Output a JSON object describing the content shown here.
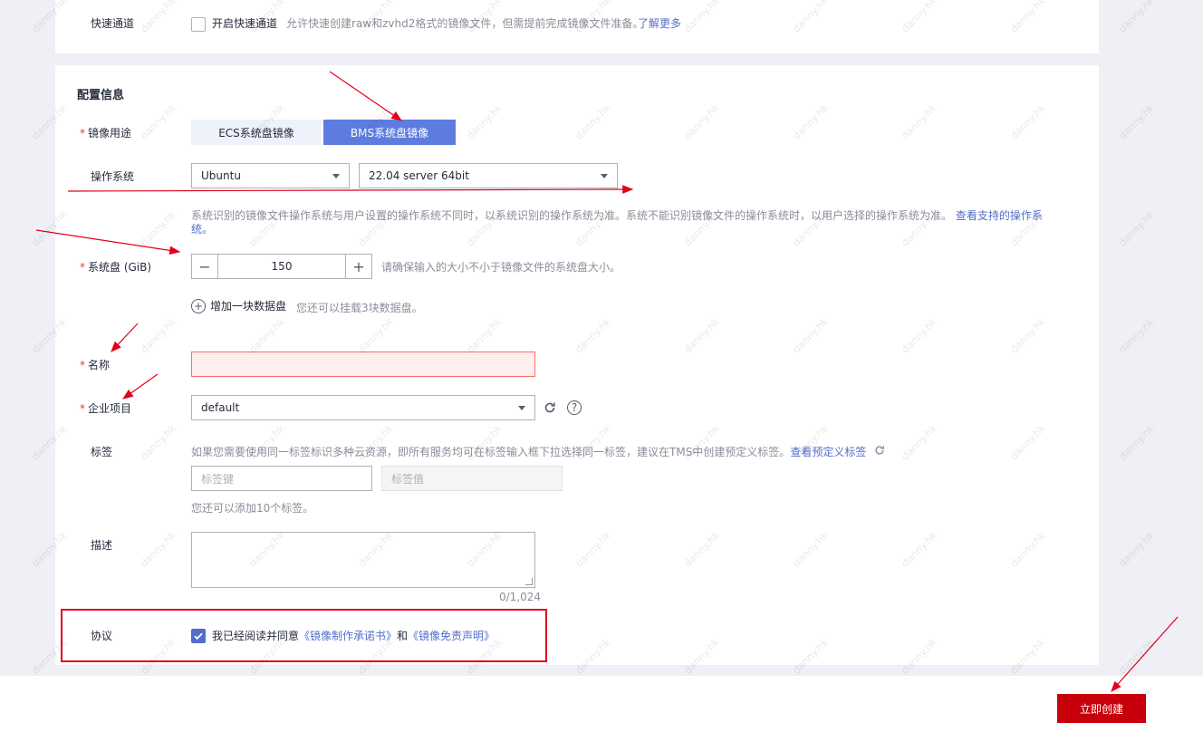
{
  "quick_channel": {
    "label": "快速通道",
    "checkbox_label": "开启快速通道",
    "hint": "允许快速创建raw和zvhd2格式的镜像文件，但需提前完成镜像文件准备。",
    "link": "了解更多"
  },
  "config": {
    "title": "配置信息",
    "usage": {
      "label": "镜像用途",
      "options": [
        "ECS系统盘镜像",
        "BMS系统盘镜像"
      ],
      "selected": "BMS系统盘镜像"
    },
    "os": {
      "label": "操作系统",
      "distro": "Ubuntu",
      "version": "22.04 server 64bit",
      "hint": "系统识别的镜像文件操作系统与用户设置的操作系统不同时，以系统识别的操作系统为准。系统不能识别镜像文件的操作系统时，以用户选择的操作系统为准。",
      "link_part1": "查看支持的操作系",
      "link_part2": "统。"
    },
    "system_disk": {
      "label": "系统盘 (GiB)",
      "value": "150",
      "minus": "−",
      "plus": "+",
      "hint": "请确保输入的大小不小于镜像文件的系统盘大小。"
    },
    "data_disk": {
      "add_label": "增加一块数据盘",
      "hint": "您还可以挂载3块数据盘。"
    },
    "name": {
      "label": "名称",
      "value": ""
    },
    "enterprise_project": {
      "label": "企业项目",
      "value": "default"
    },
    "tags": {
      "label": "标签",
      "hint": "如果您需要使用同一标签标识多种云资源，即所有服务均可在标签输入框下拉选择同一标签，建议在TMS中创建预定义标签。",
      "link": "查看预定义标签",
      "key_placeholder": "标签键",
      "value_placeholder": "标签值",
      "remaining": "您还可以添加10个标签。"
    },
    "description": {
      "label": "描述",
      "counter": "0/1,024"
    },
    "agreement": {
      "label": "协议",
      "text": "我已经阅读并同意",
      "doc1": "《镜像制作承诺书》",
      "and": "和",
      "doc2": "《镜像免责声明》",
      "checked": true
    }
  },
  "footer": {
    "create_button": "立即创建"
  },
  "watermark": "danny.hk",
  "colors": {
    "accent": "#526ecc",
    "primary_button": "#c7000b",
    "annotation": "#e0001b"
  }
}
